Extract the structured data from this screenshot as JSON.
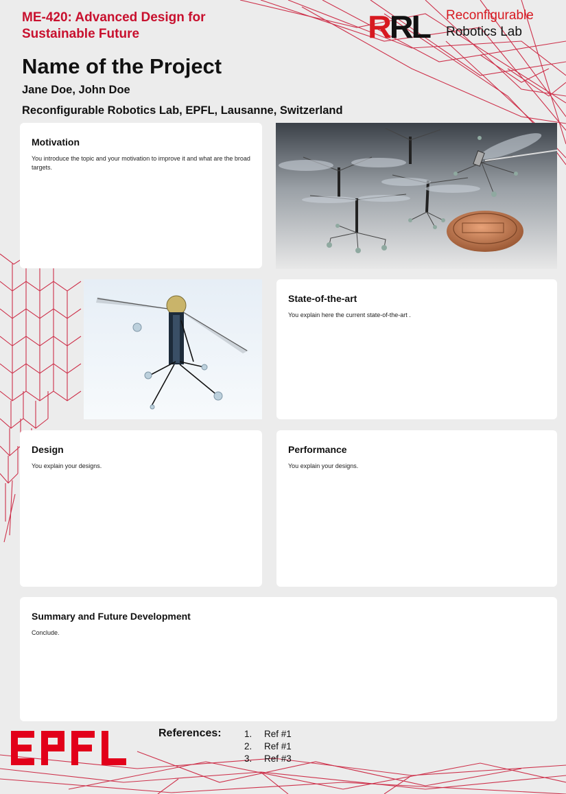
{
  "header": {
    "course_title": "ME-420: Advanced Design for Sustainable Future",
    "project_title": "Name of the Project",
    "authors": "Jane Doe, John Doe",
    "affiliation": "Reconfigurable Robotics Lab, EPFL, Lausanne, Switzerland"
  },
  "logo": {
    "mark_r1": "R",
    "mark_r2": "R",
    "mark_l": "L",
    "name_line1": "Reconfigurable",
    "name_line2": "Robotics Lab"
  },
  "panels": {
    "motivation": {
      "title": "Motivation",
      "body": "You introduce the topic and your motivation to improve it and what are the broad targets."
    },
    "state_of_the_art": {
      "title": "State-of-the-art",
      "body": "You explain here the current state-of-the-art ."
    },
    "design": {
      "title": "Design",
      "body": "You explain your designs."
    },
    "performance": {
      "title": "Performance",
      "body": "You explain your designs."
    },
    "summary": {
      "title": "Summary and Future Development",
      "body": "Conclude."
    }
  },
  "footer": {
    "epfl_logo": "EPFL",
    "references_label": "References:",
    "references": [
      {
        "num": "1.",
        "text": "Ref #1"
      },
      {
        "num": "2.",
        "text": "Ref #1"
      },
      {
        "num": "3.",
        "text": "Ref #3"
      }
    ]
  },
  "colors": {
    "accent_red": "#c8102e",
    "background": "#ececec",
    "panel": "#ffffff"
  }
}
